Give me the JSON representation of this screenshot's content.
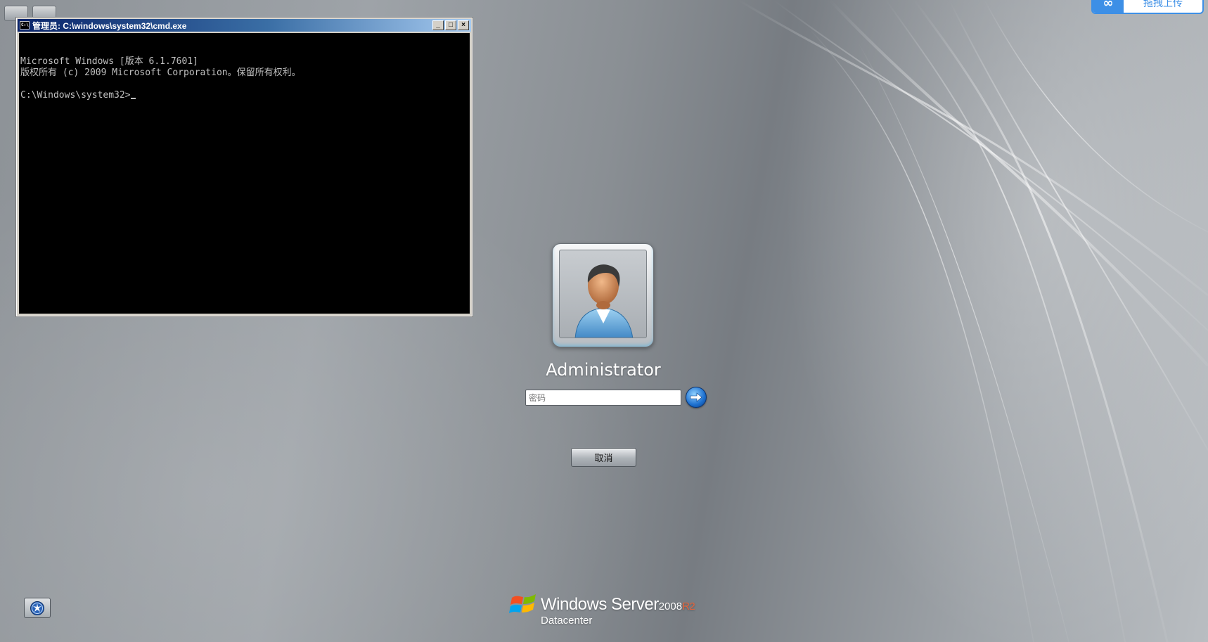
{
  "toolbar": {
    "button_1_label": "",
    "button_2_label": ""
  },
  "upload_pill": {
    "label": "拖拽上传"
  },
  "cmd": {
    "title": "管理员: C:\\windows\\system32\\cmd.exe",
    "icon_text": "C:\\",
    "controls": {
      "minimize": "_",
      "maximize": "□",
      "close": "×"
    },
    "lines": [
      "Microsoft Windows [版本 6.1.7601]",
      "版权所有 (c) 2009 Microsoft Corporation。保留所有权利。",
      "",
      "C:\\Windows\\system32>"
    ]
  },
  "login": {
    "username": "Administrator",
    "password_placeholder": "密码",
    "password_value": "",
    "submit_icon": "arrow-right-icon",
    "cancel_label": "取消"
  },
  "ease_of_access": {
    "icon": "ease-of-access-icon"
  },
  "branding": {
    "product_name": "Windows Server",
    "version": "2008",
    "release": "R2",
    "edition": "Datacenter"
  },
  "colors": {
    "accent_blue": "#3d8fe6",
    "release_orange": "#e8643a",
    "console_bg": "#000000",
    "console_fg": "#c0c0c0"
  }
}
